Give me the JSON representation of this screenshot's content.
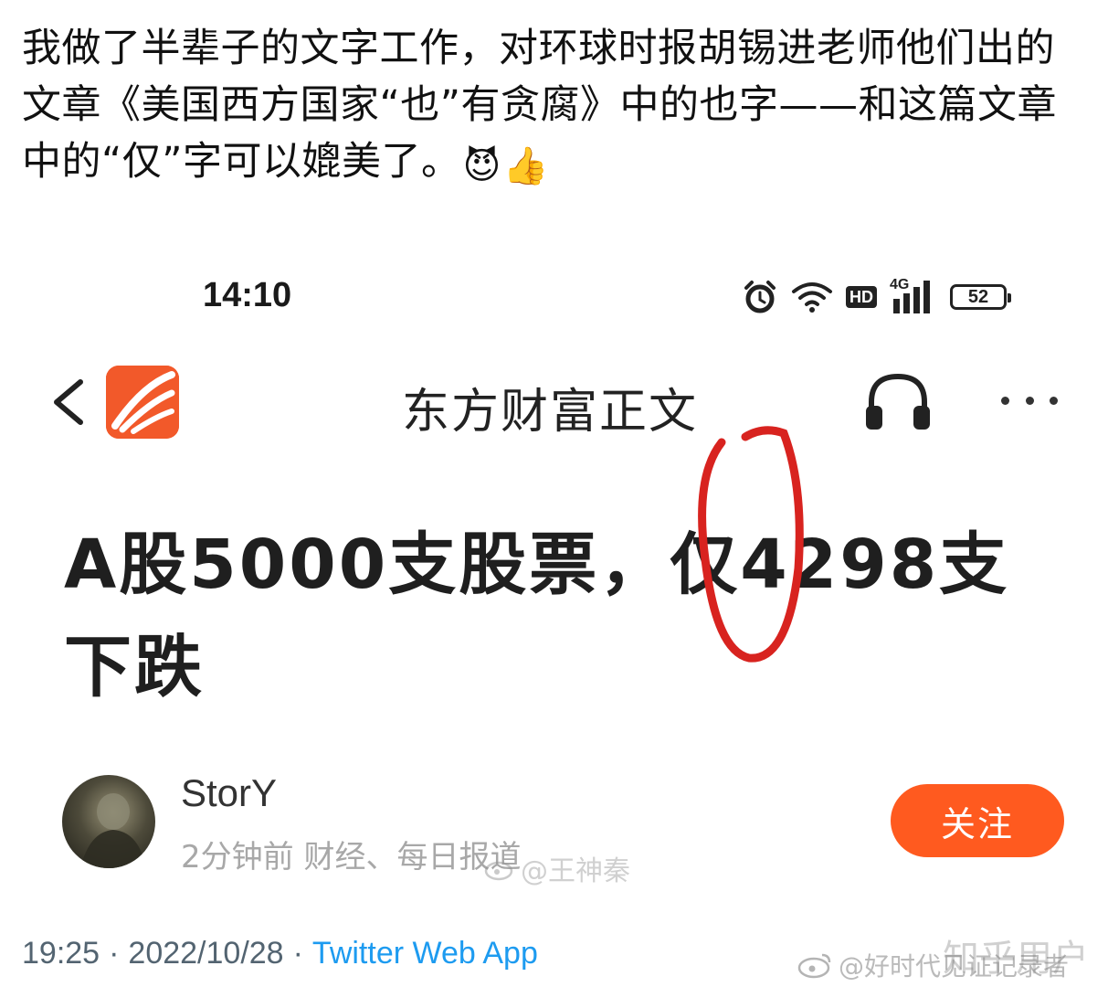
{
  "tweet": {
    "text": "我做了半辈子的文字工作，对环球时报胡锡进老师他们出的文章《美国西方国家“也”有贪腐》中的也字——和这篇文章中的“仅”字可以媲美了。",
    "emojis": [
      "😈",
      "👍"
    ],
    "time": "19:25",
    "date": "2022/10/28",
    "separator": "·",
    "source": "Twitter Web App"
  },
  "phone": {
    "status_bar": {
      "time": "14:10",
      "network": "4G",
      "hd": "HD",
      "battery": "52"
    },
    "nav": {
      "title": "东方财富正文"
    },
    "article": {
      "headline": "A股5000支股票，仅4298支下跌"
    },
    "author": {
      "name": "StorY",
      "meta": "2分钟前 财经、每日报道",
      "follow_label": "关注"
    },
    "watermark": "@王神秦"
  },
  "watermarks": {
    "zhihu": "知乎用户",
    "weibo": "@好时代见证记录者"
  },
  "colors": {
    "follow_button": "#ff5a1f",
    "app_logo": "#f2592a",
    "annotation_red": "#d8231f",
    "twitter_blue": "#1d9bf0"
  }
}
